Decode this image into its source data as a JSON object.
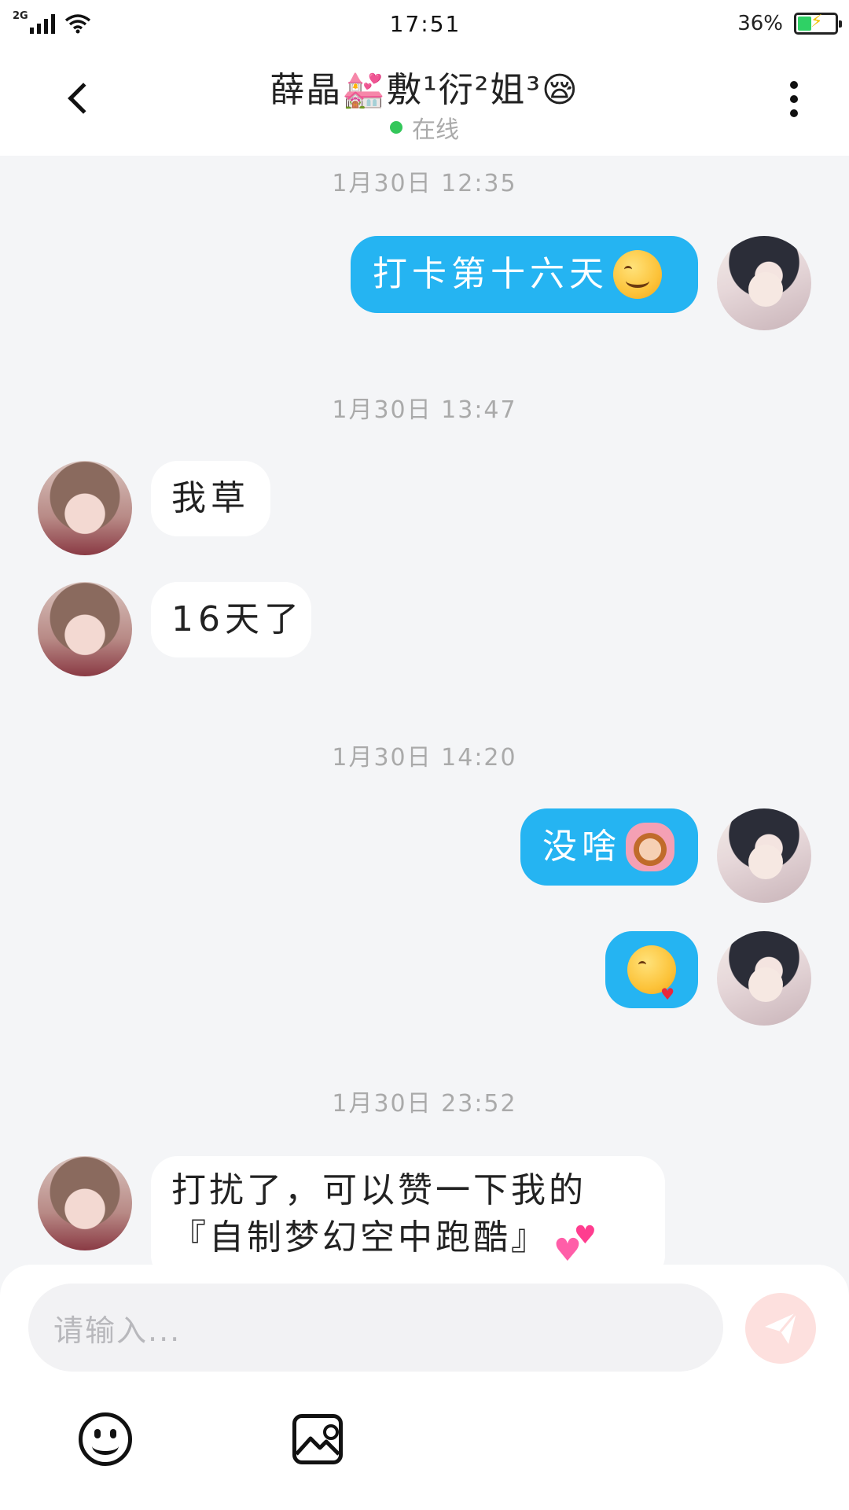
{
  "status_bar": {
    "network": "2G",
    "time": "17:51",
    "battery_percent": "36%",
    "battery_level": 0.36,
    "icons": [
      "signal-icon",
      "wifi-icon",
      "battery-icon",
      "charging-icon"
    ]
  },
  "header": {
    "title": "薛晶💒敷¹衍²姐³😪",
    "status": "在线",
    "status_color": "#33c75a"
  },
  "messages": [
    {
      "timestamp": "1月30日 12:35"
    },
    {
      "side": "me",
      "text": "打卡第十六天",
      "emoji": "smiling-face-emoji"
    },
    {
      "timestamp": "1月30日 13:47"
    },
    {
      "side": "peer",
      "text": "我草"
    },
    {
      "side": "peer",
      "text": "16天了"
    },
    {
      "timestamp": "1月30日 14:20"
    },
    {
      "side": "me",
      "text": "没啥",
      "emoji": "woman-gesturing-ok-emoji"
    },
    {
      "side": "me",
      "text": "",
      "emoji": "face-blowing-kiss-emoji"
    },
    {
      "timestamp": "1月30日 23:52"
    },
    {
      "side": "peer",
      "text_line1": "打扰了，可以赞一下我的",
      "text_line2": "『自制梦幻空中跑酷』",
      "emoji": "two-hearts-emoji"
    }
  ],
  "input": {
    "placeholder": "请输入...",
    "send_icon": "send-icon",
    "toolbar_icons": [
      "emoji-icon",
      "image-icon"
    ]
  },
  "colors": {
    "my_bubble": "#25b4f2",
    "peer_bubble": "#ffffff",
    "background": "#f4f5f7",
    "send_button": "#fde0de"
  }
}
